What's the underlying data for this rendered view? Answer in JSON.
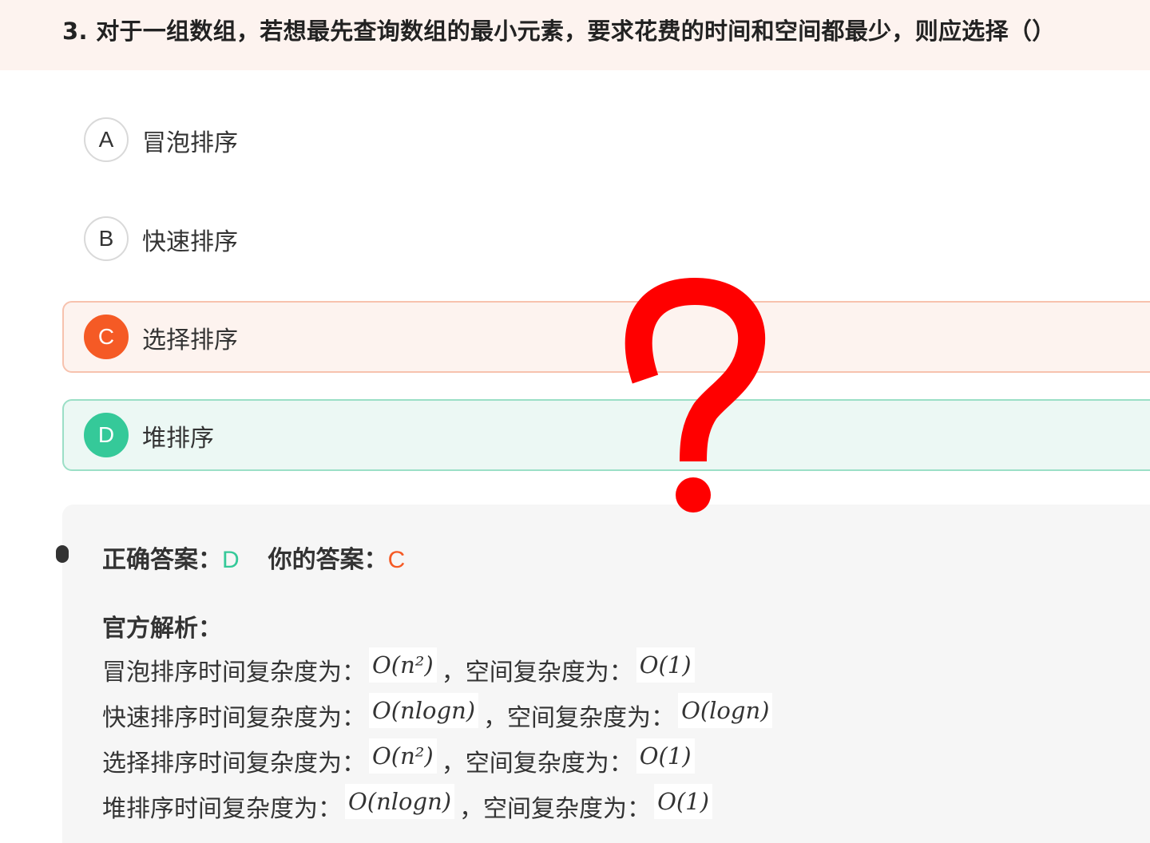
{
  "question": {
    "title": "3. 对于一组数组，若想最先查询数组的最小元素，要求花费的时间和空间都最少，则应选择（）"
  },
  "options": [
    {
      "letter": "A",
      "text": "冒泡排序",
      "state": "normal"
    },
    {
      "letter": "B",
      "text": "快速排序",
      "state": "normal"
    },
    {
      "letter": "C",
      "text": "选择排序",
      "state": "selected-wrong"
    },
    {
      "letter": "D",
      "text": "堆排序",
      "state": "correct"
    }
  ],
  "overlay": {
    "icon": "question-mark-icon",
    "color": "#ff0000"
  },
  "answer": {
    "correct_label": "正确答案：",
    "correct_value": "D",
    "yours_label": "你的答案：",
    "yours_value": "C"
  },
  "analysis": {
    "title": "官方解析：",
    "lines": [
      {
        "prefix": "冒泡排序时间复杂度为：",
        "time": "O(n²)",
        "sep": "，空间复杂度为：",
        "space": "O(1)"
      },
      {
        "prefix": "快速排序时间复杂度为：",
        "time": "O(nlogn)",
        "sep": "，空间复杂度为：",
        "space": "O(logn)"
      },
      {
        "prefix": "选择排序时间复杂度为：",
        "time": "O(n²)",
        "sep": "，空间复杂度为：",
        "space": "O(1)"
      },
      {
        "prefix": "堆排序时间复杂度为：",
        "time": "O(nlogn)",
        "sep": "，空间复杂度为：",
        "space": "O(1)"
      }
    ]
  },
  "colors": {
    "accent_wrong": "#f55a25",
    "accent_correct": "#35c999",
    "header_bg": "#fdf3ef",
    "panel_bg": "#f6f6f6"
  }
}
